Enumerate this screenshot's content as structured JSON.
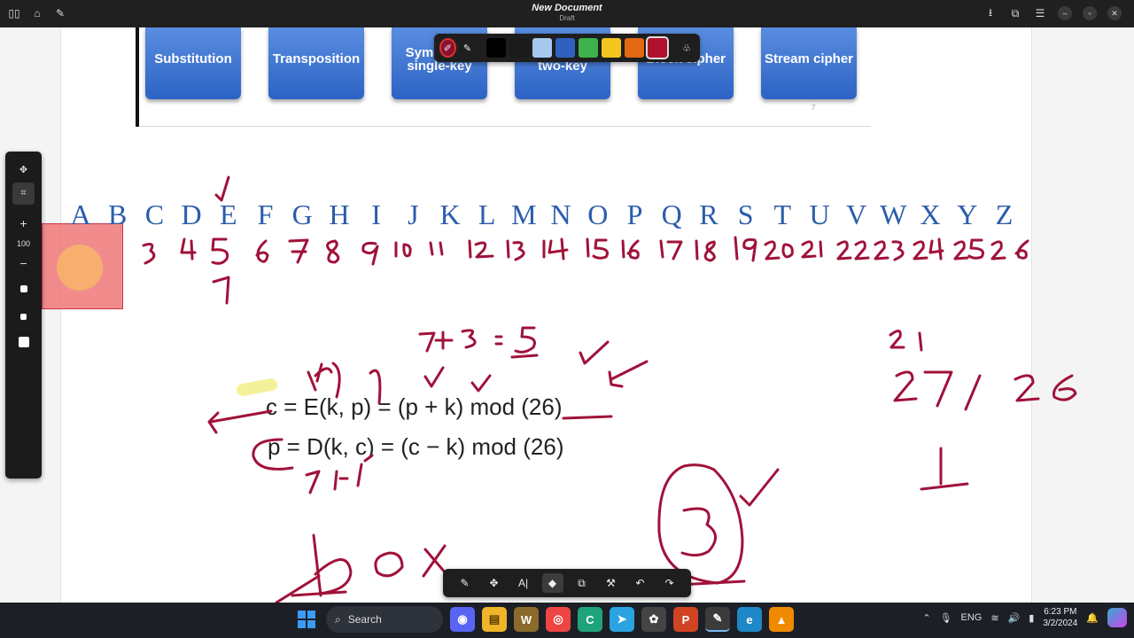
{
  "window": {
    "title": "New Document",
    "subtitle": "Draft"
  },
  "slide": {
    "buttons": [
      {
        "label": "Substitution"
      },
      {
        "label": "Transposition"
      },
      {
        "label": "Symmetric single-key"
      },
      {
        "label": "Asymmetric two-key"
      },
      {
        "label": "Block cipher"
      },
      {
        "label": "Stream cipher"
      }
    ],
    "page_number": "7"
  },
  "color_toolbar": {
    "swatches": [
      "#000000",
      "#1a1a1a",
      "#a6c8f0",
      "#2f62c0",
      "#3cb34a",
      "#f2c61f",
      "#e2690f",
      "#b0122e"
    ]
  },
  "side_toolbar": {
    "zoom_in": "+",
    "zoom_level": "100",
    "zoom_out": "−"
  },
  "alphabet": {
    "letters": [
      "A",
      "B",
      "C",
      "D",
      "E",
      "F",
      "G",
      "H",
      "I",
      "J",
      "K",
      "L",
      "M",
      "N",
      "O",
      "P",
      "Q",
      "R",
      "S",
      "T",
      "U",
      "V",
      "W",
      "X",
      "Y",
      "Z"
    ]
  },
  "formula": {
    "encrypt": "c = E(k, p) = (p + k) mod (26)",
    "decrypt": "p = D(k, c) = (c − k) mod (26)"
  },
  "draw_toolbar": {
    "text_tool": "A|"
  },
  "taskbar": {
    "search_placeholder": "Search",
    "language": "ENG",
    "time": "6:23 PM",
    "date": "3/2/2024"
  },
  "colors": {
    "ink": "#a0123a",
    "alphabet": "#2b5dab",
    "slide_button": "#2c63c4"
  }
}
